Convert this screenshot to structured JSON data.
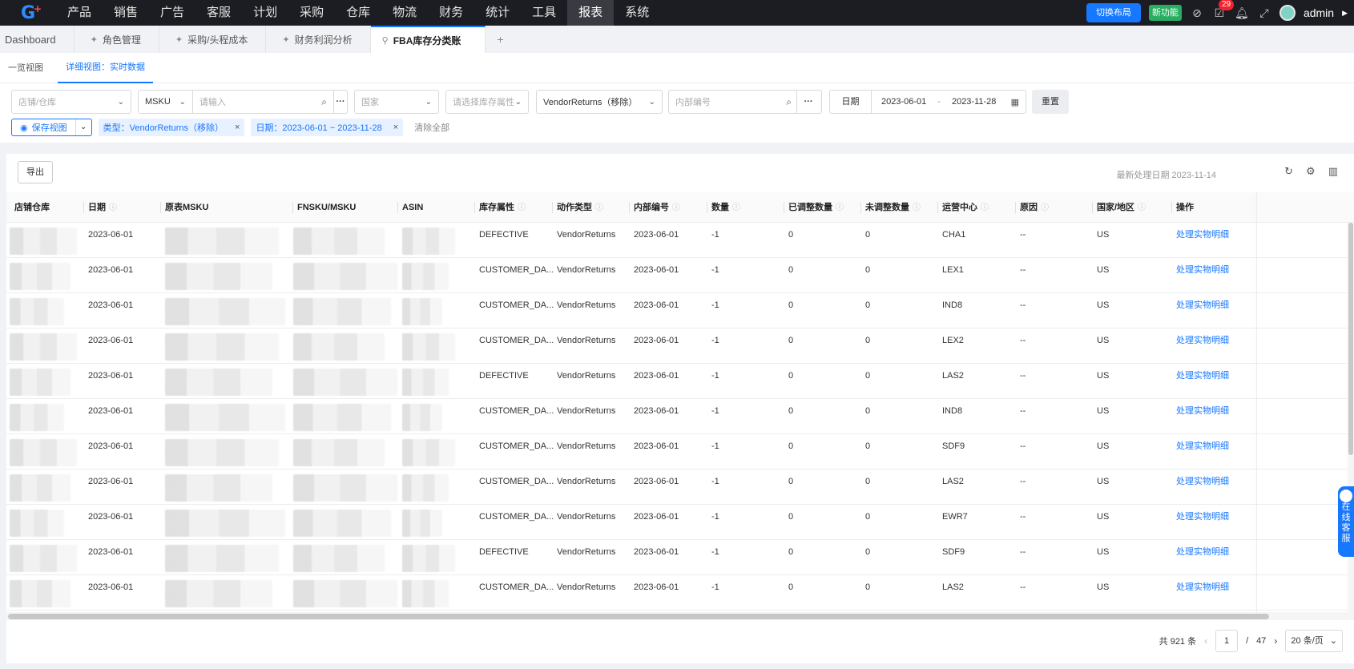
{
  "topnav": {
    "logo_letter": "G",
    "logo_plus": "+",
    "items": [
      "产品",
      "销售",
      "广告",
      "客服",
      "计划",
      "采购",
      "仓库",
      "物流",
      "财务",
      "统计",
      "工具",
      "报表",
      "系统"
    ],
    "active_index": 11,
    "switch_layout": "切换布局",
    "new_feature": "新功能",
    "notification_count": "29",
    "username": "admin"
  },
  "tabs": [
    {
      "label": "Dashboard",
      "pinned": false
    },
    {
      "label": "角色管理",
      "pinned": true
    },
    {
      "label": "采购/头程成本",
      "pinned": true
    },
    {
      "label": "财务利润分析",
      "pinned": true
    },
    {
      "label": "FBA库存分类账",
      "pinned": true,
      "active": true
    }
  ],
  "tab_add": "+",
  "views": {
    "overview": "一览视图",
    "detail": "详细视图：实时数据"
  },
  "filters": {
    "store_placeholder": "店铺/仓库",
    "msku_select": "MSKU",
    "msku_placeholder": "请输入",
    "country_placeholder": "国家",
    "inventory_attr_placeholder": "请选择库存属性",
    "type_value": "VendorReturns（移除）",
    "internal_no_placeholder": "内部编号",
    "date_label": "日期",
    "date_start": "2023-06-01",
    "date_sep": "-",
    "date_end": "2023-11-28",
    "reset": "重置",
    "save_view": "保存视图",
    "chip_type": "类型：VendorReturns（移除）",
    "chip_date": "日期：2023-06-01 ~ 2023-11-28",
    "clear_all": "清除全部"
  },
  "toolbar": {
    "export": "导出",
    "latest_date": "最新处理日期 2023-11-14"
  },
  "table": {
    "headers": [
      "店铺仓库",
      "日期",
      "原表MSKU",
      "FNSKU/MSKU",
      "ASIN",
      "库存属性",
      "动作类型",
      "内部编号",
      "数量",
      "已调整数量",
      "未调整数量",
      "运营中心",
      "原因",
      "国家/地区",
      "操作"
    ],
    "rows": [
      {
        "date": "2023-06-01",
        "attr": "DEFECTIVE",
        "action": "VendorReturns",
        "internal": "2023-06-01",
        "qty": "-1",
        "adjusted": "0",
        "unadjusted": "0",
        "center": "CHA1",
        "reason": "--",
        "country": "US",
        "op": "处理实物明细"
      },
      {
        "date": "2023-06-01",
        "attr": "CUSTOMER_DA...",
        "action": "VendorReturns",
        "internal": "2023-06-01",
        "qty": "-1",
        "adjusted": "0",
        "unadjusted": "0",
        "center": "LEX1",
        "reason": "--",
        "country": "US",
        "op": "处理实物明细"
      },
      {
        "date": "2023-06-01",
        "attr": "CUSTOMER_DA...",
        "action": "VendorReturns",
        "internal": "2023-06-01",
        "qty": "-1",
        "adjusted": "0",
        "unadjusted": "0",
        "center": "IND8",
        "reason": "--",
        "country": "US",
        "op": "处理实物明细"
      },
      {
        "date": "2023-06-01",
        "attr": "CUSTOMER_DA...",
        "action": "VendorReturns",
        "internal": "2023-06-01",
        "qty": "-1",
        "adjusted": "0",
        "unadjusted": "0",
        "center": "LEX2",
        "reason": "--",
        "country": "US",
        "op": "处理实物明细"
      },
      {
        "date": "2023-06-01",
        "attr": "DEFECTIVE",
        "action": "VendorReturns",
        "internal": "2023-06-01",
        "qty": "-1",
        "adjusted": "0",
        "unadjusted": "0",
        "center": "LAS2",
        "reason": "--",
        "country": "US",
        "op": "处理实物明细"
      },
      {
        "date": "2023-06-01",
        "attr": "CUSTOMER_DA...",
        "action": "VendorReturns",
        "internal": "2023-06-01",
        "qty": "-1",
        "adjusted": "0",
        "unadjusted": "0",
        "center": "IND8",
        "reason": "--",
        "country": "US",
        "op": "处理实物明细"
      },
      {
        "date": "2023-06-01",
        "attr": "CUSTOMER_DA...",
        "action": "VendorReturns",
        "internal": "2023-06-01",
        "qty": "-1",
        "adjusted": "0",
        "unadjusted": "0",
        "center": "SDF9",
        "reason": "--",
        "country": "US",
        "op": "处理实物明细"
      },
      {
        "date": "2023-06-01",
        "attr": "CUSTOMER_DA...",
        "action": "VendorReturns",
        "internal": "2023-06-01",
        "qty": "-1",
        "adjusted": "0",
        "unadjusted": "0",
        "center": "LAS2",
        "reason": "--",
        "country": "US",
        "op": "处理实物明细"
      },
      {
        "date": "2023-06-01",
        "attr": "CUSTOMER_DA...",
        "action": "VendorReturns",
        "internal": "2023-06-01",
        "qty": "-1",
        "adjusted": "0",
        "unadjusted": "0",
        "center": "EWR7",
        "reason": "--",
        "country": "US",
        "op": "处理实物明细"
      },
      {
        "date": "2023-06-01",
        "attr": "DEFECTIVE",
        "action": "VendorReturns",
        "internal": "2023-06-01",
        "qty": "-1",
        "adjusted": "0",
        "unadjusted": "0",
        "center": "SDF9",
        "reason": "--",
        "country": "US",
        "op": "处理实物明细"
      },
      {
        "date": "2023-06-01",
        "attr": "CUSTOMER_DA...",
        "action": "VendorReturns",
        "internal": "2023-06-01",
        "qty": "-1",
        "adjusted": "0",
        "unadjusted": "0",
        "center": "LAS2",
        "reason": "--",
        "country": "US",
        "op": "处理实物明细"
      }
    ]
  },
  "pagination": {
    "total": "共 921 条",
    "current_page": "1",
    "slash": "/",
    "total_pages": "47",
    "page_size": "20 条/页"
  },
  "customer_service": "在线客服",
  "colors": {
    "accent": "#1677ff",
    "nav_bg": "#1c1d22",
    "new_badge": "#27ae60"
  }
}
